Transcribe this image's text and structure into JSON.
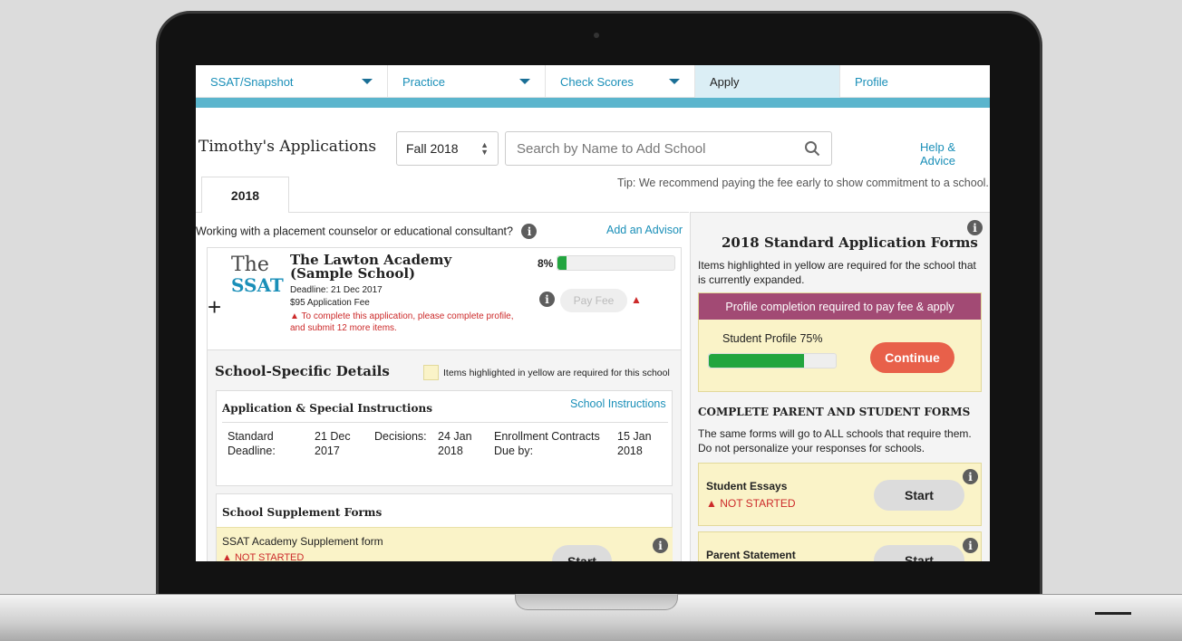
{
  "nav": {
    "items": [
      {
        "label": "SSAT/Snapshot",
        "has_dropdown": true
      },
      {
        "label": "Practice",
        "has_dropdown": true
      },
      {
        "label": "Check Scores",
        "has_dropdown": true
      },
      {
        "label": "Apply",
        "has_dropdown": false,
        "active": true
      },
      {
        "label": "Profile",
        "has_dropdown": false
      }
    ]
  },
  "header": {
    "title": "Timothy's Applications",
    "term_select": "Fall 2018",
    "search_placeholder": "Search by Name to Add School",
    "help_link": "Help & Advice",
    "tab": "2018",
    "tip": "Tip: We recommend paying the fee early to show commitment to a school."
  },
  "counselor": {
    "question": "Working with a placement counselor or educational consultant?",
    "add_advisor": "Add an Advisor"
  },
  "school": {
    "logo_the": "The",
    "logo_ssat": "SSAT",
    "plus": "+",
    "name": "The Lawton Academy (Sample School)",
    "deadline": "Deadline: 21 Dec 2017",
    "fee": "$95 Application Fee",
    "warning": "▲ To complete this application, please complete profile, and submit 12 more items.",
    "progress_label": "8%",
    "progress_fraction": 0.08,
    "pay_fee_button": "Pay Fee",
    "alert_icon": "▲"
  },
  "details": {
    "title": "School-Specific Details",
    "yellow_note": "Items highlighted in yellow are required for this school",
    "instructions": {
      "title": "Application & Special Instructions",
      "link": "School Instructions",
      "standard_label": "Standard Deadline:",
      "standard_value": "21 Dec 2017",
      "decisions_label": "Decisions:",
      "decisions_value": "24 Jan 2018",
      "enrollment_label": "Enrollment Contracts Due by:",
      "enrollment_value": "15 Jan 2018"
    },
    "supplement": {
      "title": "School Supplement Forms",
      "form_name": "SSAT Academy Supplement form",
      "status": "▲ NOT STARTED",
      "start_button": "Start"
    }
  },
  "right": {
    "title": "2018 Standard Application Forms",
    "desc": "Items highlighted in yellow are required for the school that is currently expanded.",
    "profile_banner": "Profile completion required to pay fee & apply",
    "profile_label": "Student Profile 75%",
    "profile_fraction": 0.75,
    "continue_button": "Continue",
    "forms_heading": "COMPLETE PARENT AND STUDENT FORMS",
    "forms_note": "The same forms will go to ALL schools that require them. Do not personalize your responses for schools.",
    "forms": [
      {
        "name": "Student Essays",
        "status": "▲ NOT STARTED",
        "button": "Start"
      },
      {
        "name": "Parent Statement",
        "status": "",
        "button": "Start"
      }
    ]
  },
  "icons": {
    "info": "i",
    "search": "search-icon",
    "caret": "chevron-down-icon"
  },
  "colors": {
    "accent": "#1a8fb8",
    "stripe": "#5bb5cd",
    "progress": "#22a53f",
    "banner": "#a24a74",
    "continue": "#e8604a",
    "required_yellow": "#faf3c8",
    "error": "#cc2a2a"
  }
}
